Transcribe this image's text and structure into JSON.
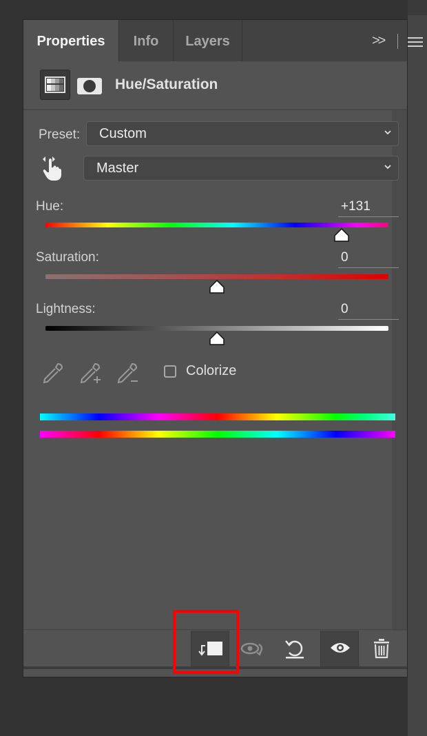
{
  "tabs": [
    {
      "label": "Properties",
      "active": true
    },
    {
      "label": "Info",
      "active": false
    },
    {
      "label": "Layers",
      "active": false
    }
  ],
  "tab_menu": {
    "expand_glyph": ">>",
    "menu_icon": "hamburger-menu-icon"
  },
  "header": {
    "title": "Hue/Saturation",
    "adjustment_icon": "hue-saturation-adjustment-icon",
    "mask_icon": "layer-mask-icon"
  },
  "preset": {
    "label": "Preset:",
    "value": "Custom"
  },
  "channel": {
    "value": "Master",
    "icon": "targeted-adjustment-hand-icon"
  },
  "sliders": {
    "hue": {
      "label": "Hue:",
      "value": "+131",
      "numeric": 131,
      "range": [
        -180,
        180
      ]
    },
    "saturation": {
      "label": "Saturation:",
      "value": "0",
      "numeric": 0,
      "range": [
        -100,
        100
      ]
    },
    "lightness": {
      "label": "Lightness:",
      "value": "0",
      "numeric": 0,
      "range": [
        -100,
        100
      ]
    }
  },
  "eyedroppers": [
    "eyedropper-icon",
    "eyedropper-add-icon",
    "eyedropper-subtract-icon"
  ],
  "colorize": {
    "label": "Colorize",
    "checked": false
  },
  "footer_buttons": [
    {
      "name": "clip-to-layer-icon",
      "pressed": true,
      "highlighted": true
    },
    {
      "name": "view-previous-state-icon",
      "pressed": false
    },
    {
      "name": "reset-icon",
      "pressed": false
    },
    {
      "name": "visibility-eye-icon",
      "pressed": true
    },
    {
      "name": "trash-icon",
      "pressed": false
    }
  ],
  "colors": {
    "highlight": "#ff0000",
    "panel_bg": "#535353"
  }
}
